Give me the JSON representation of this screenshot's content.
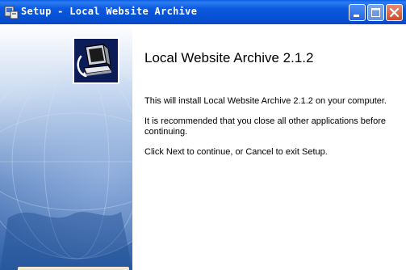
{
  "window": {
    "title": "Setup - Local Website Archive"
  },
  "titlebar_buttons": {
    "minimize_icon": "minimize-icon",
    "maximize_icon": "maximize-icon",
    "close_icon": "close-icon"
  },
  "main": {
    "heading": "Local Website Archive 2.1.2",
    "paragraphs": [
      "This will install Local Website Archive 2.1.2 on your computer.",
      "It is recommended that you close all other applications before continuing.",
      "Click Next to continue, or Cancel to exit Setup."
    ]
  },
  "colors": {
    "titlebar": "#0652d4",
    "close_button": "#d04a2a",
    "panel_dark": "#2e5fa7"
  }
}
